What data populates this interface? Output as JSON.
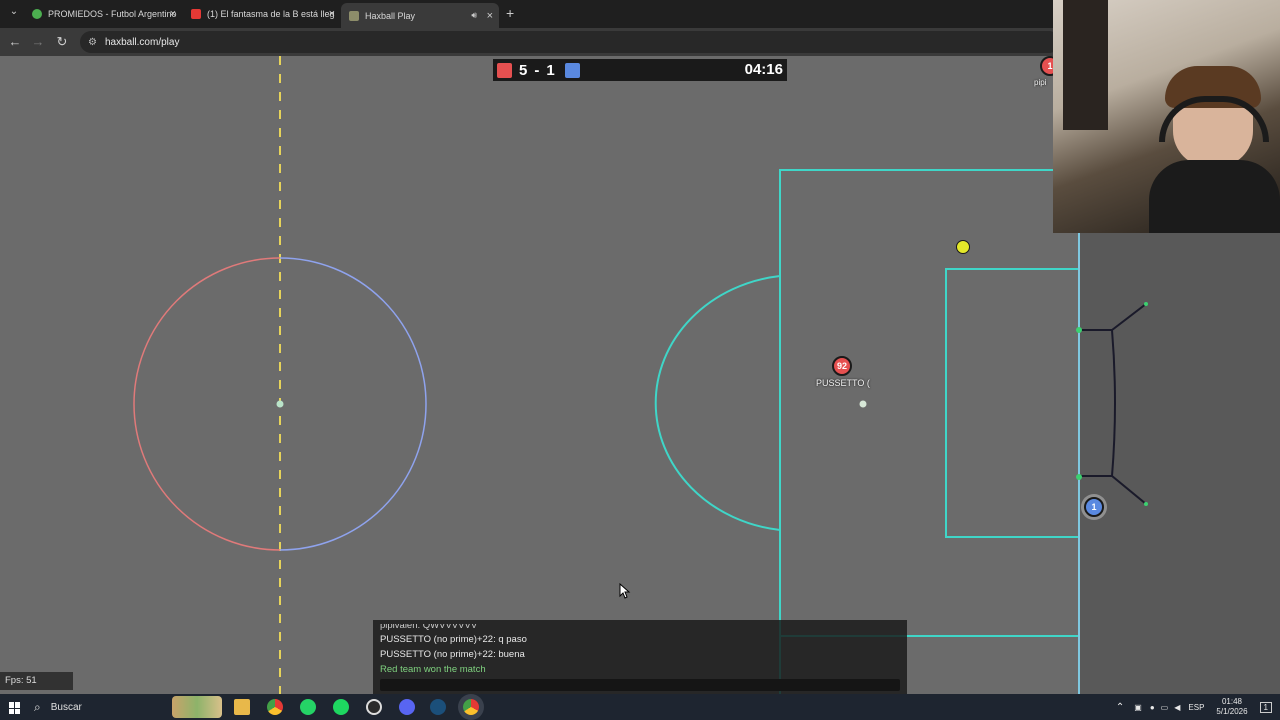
{
  "browser": {
    "tabs": [
      {
        "title": "PROMIEDOS - Futbol Argentino",
        "favicon_color": "#4caf50"
      },
      {
        "title": "(1) El fantasma de la B está lleg",
        "favicon_color": "#e53935"
      },
      {
        "title": "Haxball Play",
        "favicon_color": "#8d8d6a"
      }
    ],
    "new_tab": "+",
    "close_glyph": "×",
    "url": "haxball.com/play"
  },
  "game": {
    "score": {
      "red": "5",
      "separator": "-",
      "blue": "1",
      "time": "04:16",
      "red_color": "#e55050",
      "blue_color": "#5a89e0"
    },
    "players": [
      {
        "number": "92",
        "name": "PUSSETTO (",
        "team": "red"
      },
      {
        "number": "1",
        "name": "",
        "team": "blue"
      }
    ],
    "offscreen_player": {
      "number": "1",
      "name": "pipi"
    },
    "fps": "Fps: 51",
    "colors": {
      "field": "#6b6b6b",
      "lines": "#3fd6c8",
      "midline": "#e6d35a",
      "ball": "#e4e82a"
    }
  },
  "chat": {
    "partial_line": "pipivalen: QWVVVVVV",
    "messages": [
      "PUSSETTO (no prime)+22: q paso",
      "PUSSETTO (no prime)+22: buena"
    ],
    "notice": "Red team won the match"
  },
  "taskbar": {
    "search_label": "Buscar",
    "language": "ESP",
    "time": "01:48",
    "date": "5/1/2026",
    "notification_count": "1"
  }
}
